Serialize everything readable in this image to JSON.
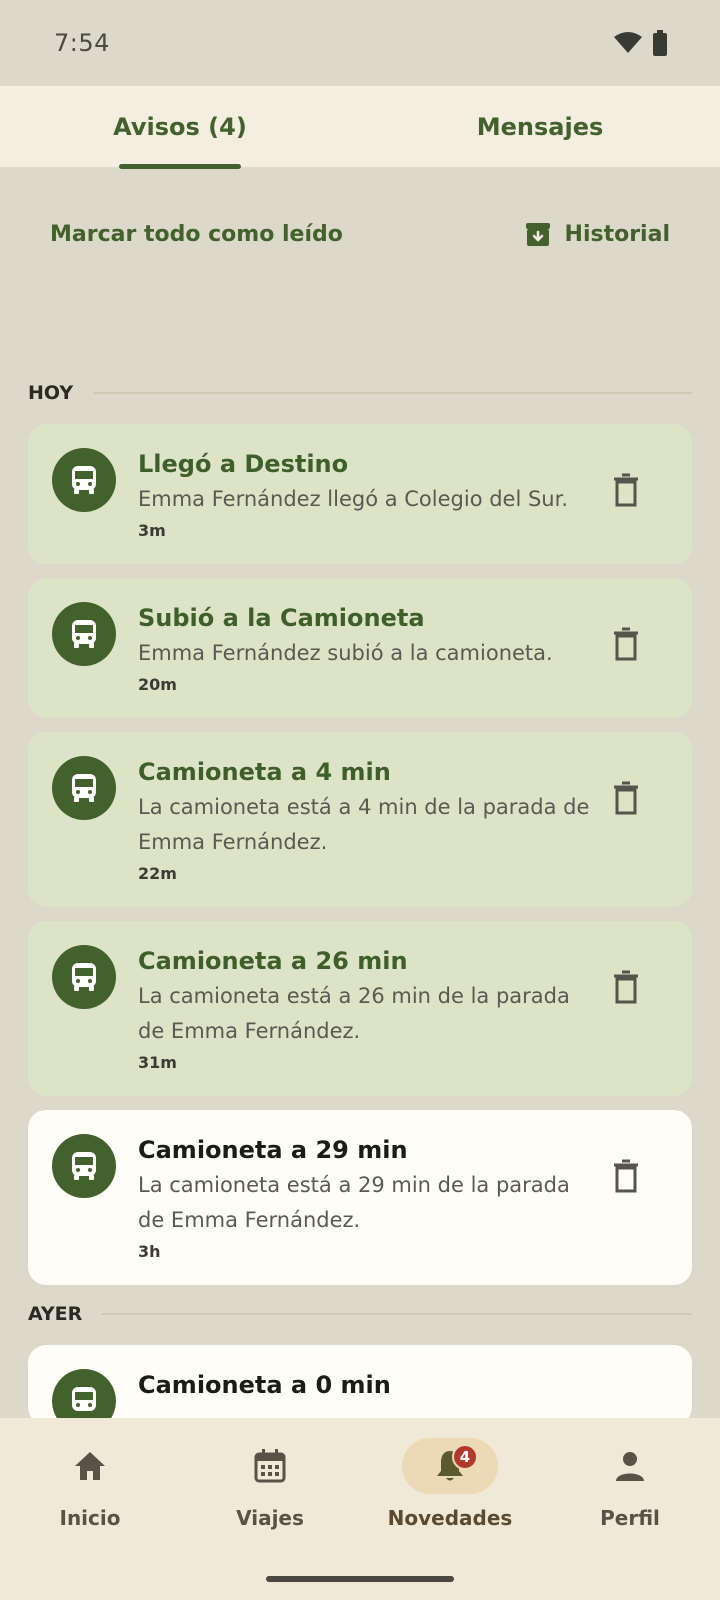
{
  "status_bar": {
    "time": "7:54"
  },
  "tabs": [
    {
      "label": "Avisos (4)"
    },
    {
      "label": "Mensajes"
    }
  ],
  "actions": {
    "mark_all_read": "Marcar todo como leído",
    "history": "Historial"
  },
  "sections": {
    "today": "HOY",
    "yesterday": "AYER"
  },
  "notifications": [
    {
      "title": "Llegó a Destino",
      "text": "Emma Fernández llegó a Colegio del Sur.",
      "time": "3m",
      "read": false
    },
    {
      "title": "Subió a la Camioneta",
      "text": "Emma Fernández subió a la camioneta.",
      "time": "20m",
      "read": false
    },
    {
      "title": "Camioneta a 4 min",
      "text": "La camioneta está a 4 min de la parada de Emma Fernández.",
      "time": "22m",
      "read": false
    },
    {
      "title": "Camioneta a 26 min",
      "text": "La camioneta está a 26 min de la parada de Emma Fernández.",
      "time": "31m",
      "read": false
    },
    {
      "title": "Camioneta a 29 min",
      "text": "La camioneta está a 29 min de la parada de Emma Fernández.",
      "time": "3h",
      "read": true
    },
    {
      "title": "Camioneta a 0 min",
      "text": "",
      "time": "",
      "read": true
    }
  ],
  "bottom_nav": {
    "items": [
      {
        "label": "Inicio",
        "icon": "home-icon"
      },
      {
        "label": "Viajes",
        "icon": "calendar-icon"
      },
      {
        "label": "Novedades",
        "icon": "bell-icon",
        "badge": "4"
      },
      {
        "label": "Perfil",
        "icon": "person-icon"
      }
    ]
  },
  "colors": {
    "accent": "#43612c",
    "unread_card": "#dde3c7",
    "read_card": "#fefdf7",
    "badge": "#b23a2c"
  }
}
